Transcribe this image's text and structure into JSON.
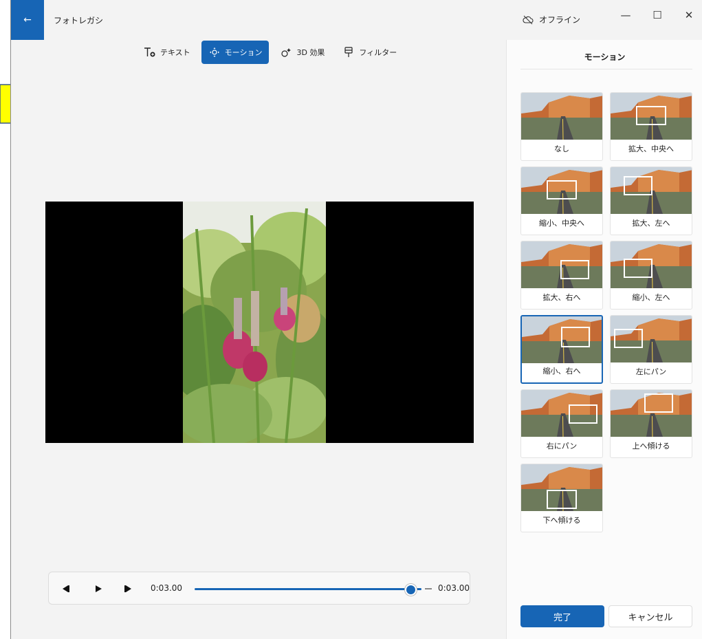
{
  "window": {
    "title": "フォトレガシ",
    "offline_label": "オフライン",
    "controls": [
      "minimize",
      "maximize",
      "close"
    ]
  },
  "toolbar": {
    "items": [
      {
        "label": "テキスト",
        "icon": "text-icon",
        "active": false
      },
      {
        "label": "モーション",
        "icon": "motion-icon",
        "active": true
      },
      {
        "label": "3D 効果",
        "icon": "3d-effects-icon",
        "active": false
      },
      {
        "label": "フィルター",
        "icon": "filter-icon",
        "active": false
      }
    ]
  },
  "player": {
    "current_time": "0:03.00",
    "total_time": "0:03.00",
    "progress": 1.0
  },
  "panel": {
    "title": "モーション",
    "options": [
      {
        "label": "なし",
        "selected": false
      },
      {
        "label": "拡大、中央へ",
        "selected": false
      },
      {
        "label": "縮小、中央へ",
        "selected": false
      },
      {
        "label": "拡大、左へ",
        "selected": false
      },
      {
        "label": "拡大、右へ",
        "selected": false
      },
      {
        "label": "縮小、左へ",
        "selected": false
      },
      {
        "label": "縮小、右へ",
        "selected": true
      },
      {
        "label": "左にパン",
        "selected": false
      },
      {
        "label": "右にパン",
        "selected": false
      },
      {
        "label": "上へ傾ける",
        "selected": false
      },
      {
        "label": "下へ傾ける",
        "selected": false
      }
    ],
    "done_label": "完了",
    "cancel_label": "キャンセル"
  },
  "colors": {
    "accent": "#1765b5",
    "annotation_arrow": "#ffff00"
  }
}
